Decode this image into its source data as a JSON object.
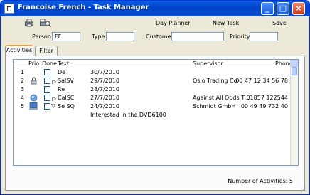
{
  "window": {
    "title": "Francoise French - Task Manager",
    "minimize": "_",
    "maximize": "□",
    "close": "×"
  },
  "toolbar": {
    "day_planner": "Day Planner",
    "new_task": "New Task",
    "save": "Save"
  },
  "fields": {
    "person_label": "Person",
    "person_value": "FF",
    "type_label": "Type",
    "type_value": "",
    "customer_label": "Customer",
    "customer_value": "",
    "priority_label": "Priority",
    "priority_value": ""
  },
  "tabs": [
    {
      "label": "Activities"
    },
    {
      "label": "Filter"
    }
  ],
  "grid": {
    "headers": {
      "prio": "Prio",
      "done": "Done",
      "text": "Text",
      "supervisor": "Supervisor",
      "phone": "Phone"
    },
    "rows": [
      {
        "num": "1",
        "arrow": "",
        "text": "De",
        "date": "30/7/2010",
        "supervisor": "",
        "phone": ""
      },
      {
        "num": "2",
        "arrow": "▷",
        "text": "SalSV",
        "date": "29/7/2010",
        "supervisor": "Oslo Trading Co",
        "phone": "00 47 12 34 56 78"
      },
      {
        "num": "3",
        "arrow": "",
        "text": "Re",
        "date": "28/7/2010",
        "supervisor": "",
        "phone": ""
      },
      {
        "num": "4",
        "arrow": "▷",
        "text": "CalSC",
        "date": "27/7/2010",
        "supervisor": "Against All Odds T...",
        "phone": "01857 122544"
      },
      {
        "num": "5",
        "arrow": "▽",
        "text": "Se SQ",
        "date": "24/7/2010",
        "supervisor": "Schmidt GmbH",
        "phone": "00 49 49 732 40"
      }
    ],
    "detail_text": "Interested in the DVD6100"
  },
  "footer": {
    "count": "Number of Activities: 5"
  }
}
